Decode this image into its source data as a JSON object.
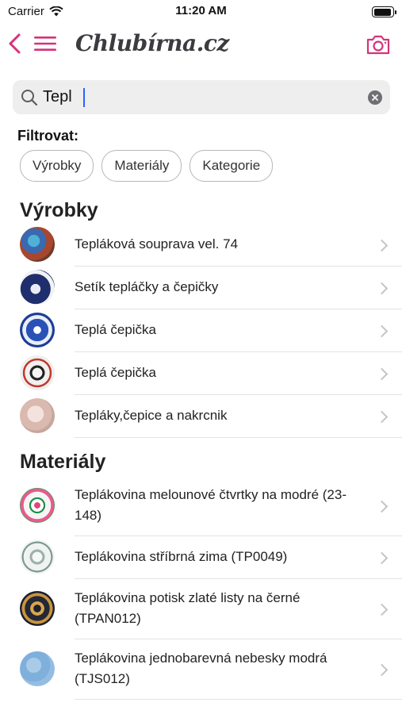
{
  "status_bar": {
    "carrier": "Carrier",
    "time": "11:20 AM"
  },
  "header": {
    "brand": "Chlubírna.cz",
    "accent_color": "#d5337a"
  },
  "search": {
    "value": "Tepl"
  },
  "filter": {
    "label": "Filtrovat:",
    "chips": [
      "Výrobky",
      "Materiály",
      "Kategorie"
    ]
  },
  "sections": {
    "products": {
      "title": "Výrobky",
      "items": [
        {
          "label": "Tepláková souprava vel. 74"
        },
        {
          "label": "Setík tepláčky a čepičky"
        },
        {
          "label": "Teplá čepička"
        },
        {
          "label": "Teplá čepička"
        },
        {
          "label": "Tepláky,čepice a nakrcnik"
        }
      ]
    },
    "materials": {
      "title": "Materiály",
      "items": [
        {
          "label": "Teplákovina melounové čtvrtky na modré (23-148)"
        },
        {
          "label": "Teplákovina stříbrná zima (TP0049)"
        },
        {
          "label": "Teplákovina potisk zlaté listy na černé (TPAN012)"
        },
        {
          "label": "Teplákovina jednobarevná nebesky modrá (TJS012)"
        }
      ]
    }
  }
}
